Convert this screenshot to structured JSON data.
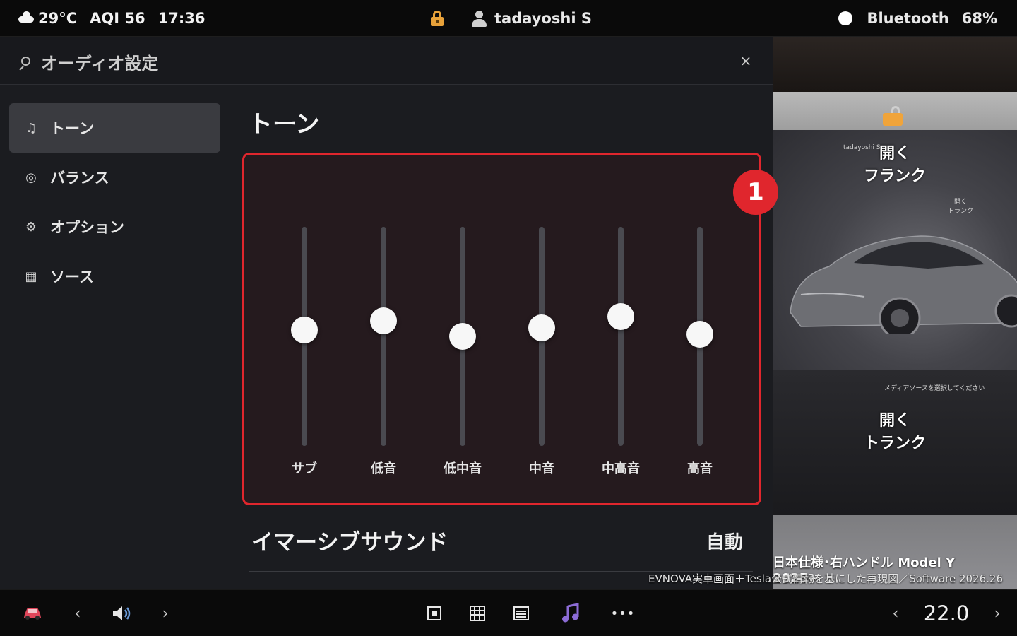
{
  "status": {
    "temperature": "29°C",
    "aqi": "AQI 56",
    "time": "17:36",
    "user": "tadayoshi S",
    "bluetooth": "Bluetooth",
    "battery": "68%"
  },
  "panel": {
    "title": "オーディオ設定",
    "close": "×"
  },
  "sidebar": {
    "items": [
      {
        "label": "トーン",
        "icon": "music-note-icon"
      },
      {
        "label": "バランス",
        "icon": "target-icon"
      },
      {
        "label": "オプション",
        "icon": "gear-icon"
      },
      {
        "label": "ソース",
        "icon": "grid-icon"
      }
    ],
    "active": "トーン"
  },
  "tone": {
    "title": "トーン",
    "badge": "1",
    "bands": [
      {
        "label": "サブ",
        "level": 0.53
      },
      {
        "label": "低音",
        "level": 0.57
      },
      {
        "label": "低中音",
        "level": 0.5
      },
      {
        "label": "中音",
        "level": 0.54
      },
      {
        "label": "中高音",
        "level": 0.59
      },
      {
        "label": "高音",
        "level": 0.51
      }
    ]
  },
  "immersive": {
    "label": "イマーシブサウンド",
    "value": "自動"
  },
  "carview": {
    "frunk_line1": "開く",
    "frunk_line2": "フランク",
    "trunk_line1": "開く",
    "trunk_line2": "トランク",
    "small_user": "tadayoshi S",
    "small_trunk": "開く\nトランク",
    "media_hint": "メディアソースを選択してください",
    "caption_main": "日本仕様･右ハンドル Model Y 2025+",
    "caption_sub": "EVNOVA実車画面＋Tesla公式情報を基にした再現図／Software 2026.26"
  },
  "dock": {
    "temperature": "22.0",
    "left_chev": "‹",
    "right_chev": "›",
    "more": "•••"
  },
  "colors": {
    "accent_red": "#e0262d",
    "lock_orange": "#e8a23a",
    "music_purple": "#8c6cd6"
  }
}
